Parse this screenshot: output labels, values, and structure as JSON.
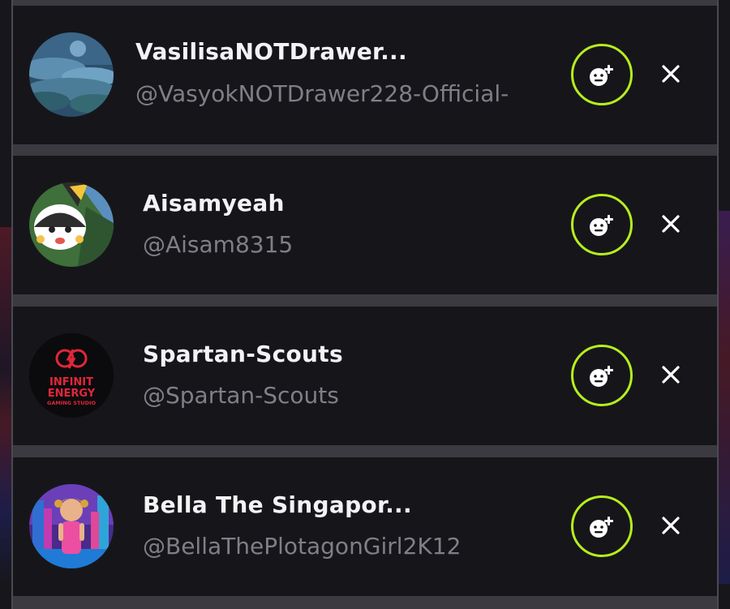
{
  "suggestions": [
    {
      "display_name": "VasilisaNOTDrawer...",
      "handle": "@VasyokNOTDrawer228-Official-"
    },
    {
      "display_name": "Aisamyeah",
      "handle": "@Aisam8315"
    },
    {
      "display_name": "Spartan-Scouts",
      "handle": "@Spartan-Scouts",
      "avatar_text": [
        "INFINIT",
        "ENERGY",
        "GAMING STUDIO"
      ]
    },
    {
      "display_name": "Bella The Singapor...",
      "handle": "@BellaThePlotagonGirl2K12"
    }
  ],
  "colors": {
    "accent": "#b6ee1e",
    "card_bg": "#16161a",
    "separator": "#3a3a40",
    "name_text": "#f3f3f5",
    "handle_text": "#7f7f87"
  },
  "icons": {
    "follow": "add-friend-icon",
    "dismiss": "close-icon"
  }
}
